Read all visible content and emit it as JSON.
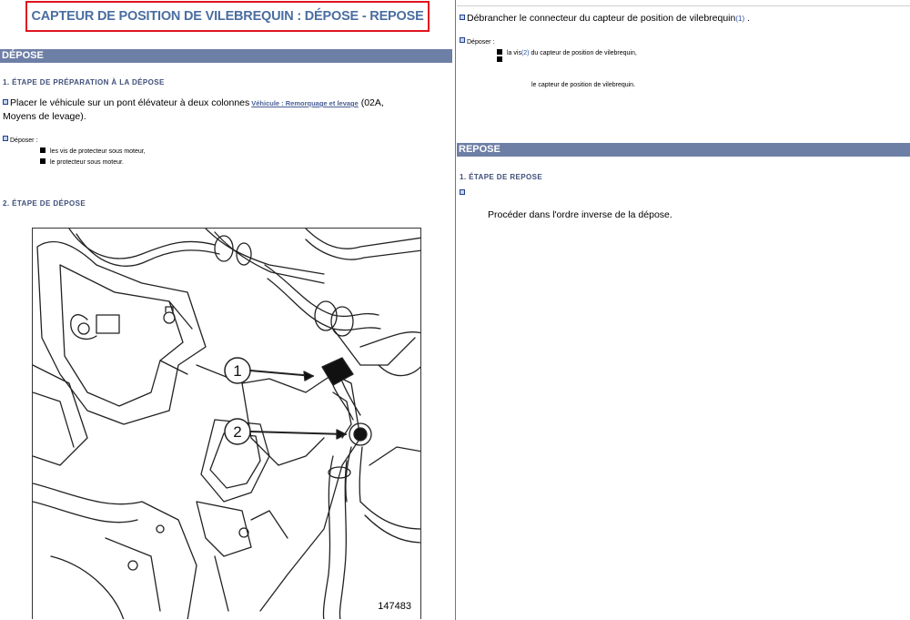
{
  "title": "CAPTEUR DE POSITION DE VILEBREQUIN : DÉPOSE - REPOSE",
  "depose": {
    "heading": "DÉPOSE",
    "step1": {
      "title": "1. ÉTAPE DE PRÉPARATION À LA DÉPOSE",
      "text1": "Placer le véhicule sur un pont élévateur à deux colonnes",
      "link": "Véhicule : Remorquage et levage",
      "text2": " (02A,",
      "text3": "Moyens de levage).",
      "remove_label": "Déposer :",
      "items": [
        "les vis de protecteur sous moteur,",
        "le protecteur sous moteur."
      ]
    },
    "step2": {
      "title": "2. ÉTAPE DE DÉPOSE",
      "figure": {
        "number": "147483",
        "callout1": "1",
        "callout2": "2"
      }
    }
  },
  "right": {
    "disconnect_before": "Débrancher le connecteur du capteur de position de vilebrequin",
    "disconnect_ref": "(1)",
    "disconnect_after": " .",
    "remove_label": "Déposer :",
    "item1_before": "la vis",
    "item1_ref": "(2)",
    "item1_after": " du capteur de position de vilebrequin,",
    "item2": "le capteur de position de vilebrequin."
  },
  "repose": {
    "heading": "REPOSE",
    "step1": {
      "title": "1. ÉTAPE DE REPOSE",
      "text": "Procéder dans l'ordre inverse de la dépose."
    }
  },
  "colors": {
    "title": "#4a6ea0",
    "title_border": "#e0141e",
    "section_bar": "#6e7fa6",
    "step_title": "#3f4f7a",
    "ref": "#2b4fa8"
  }
}
